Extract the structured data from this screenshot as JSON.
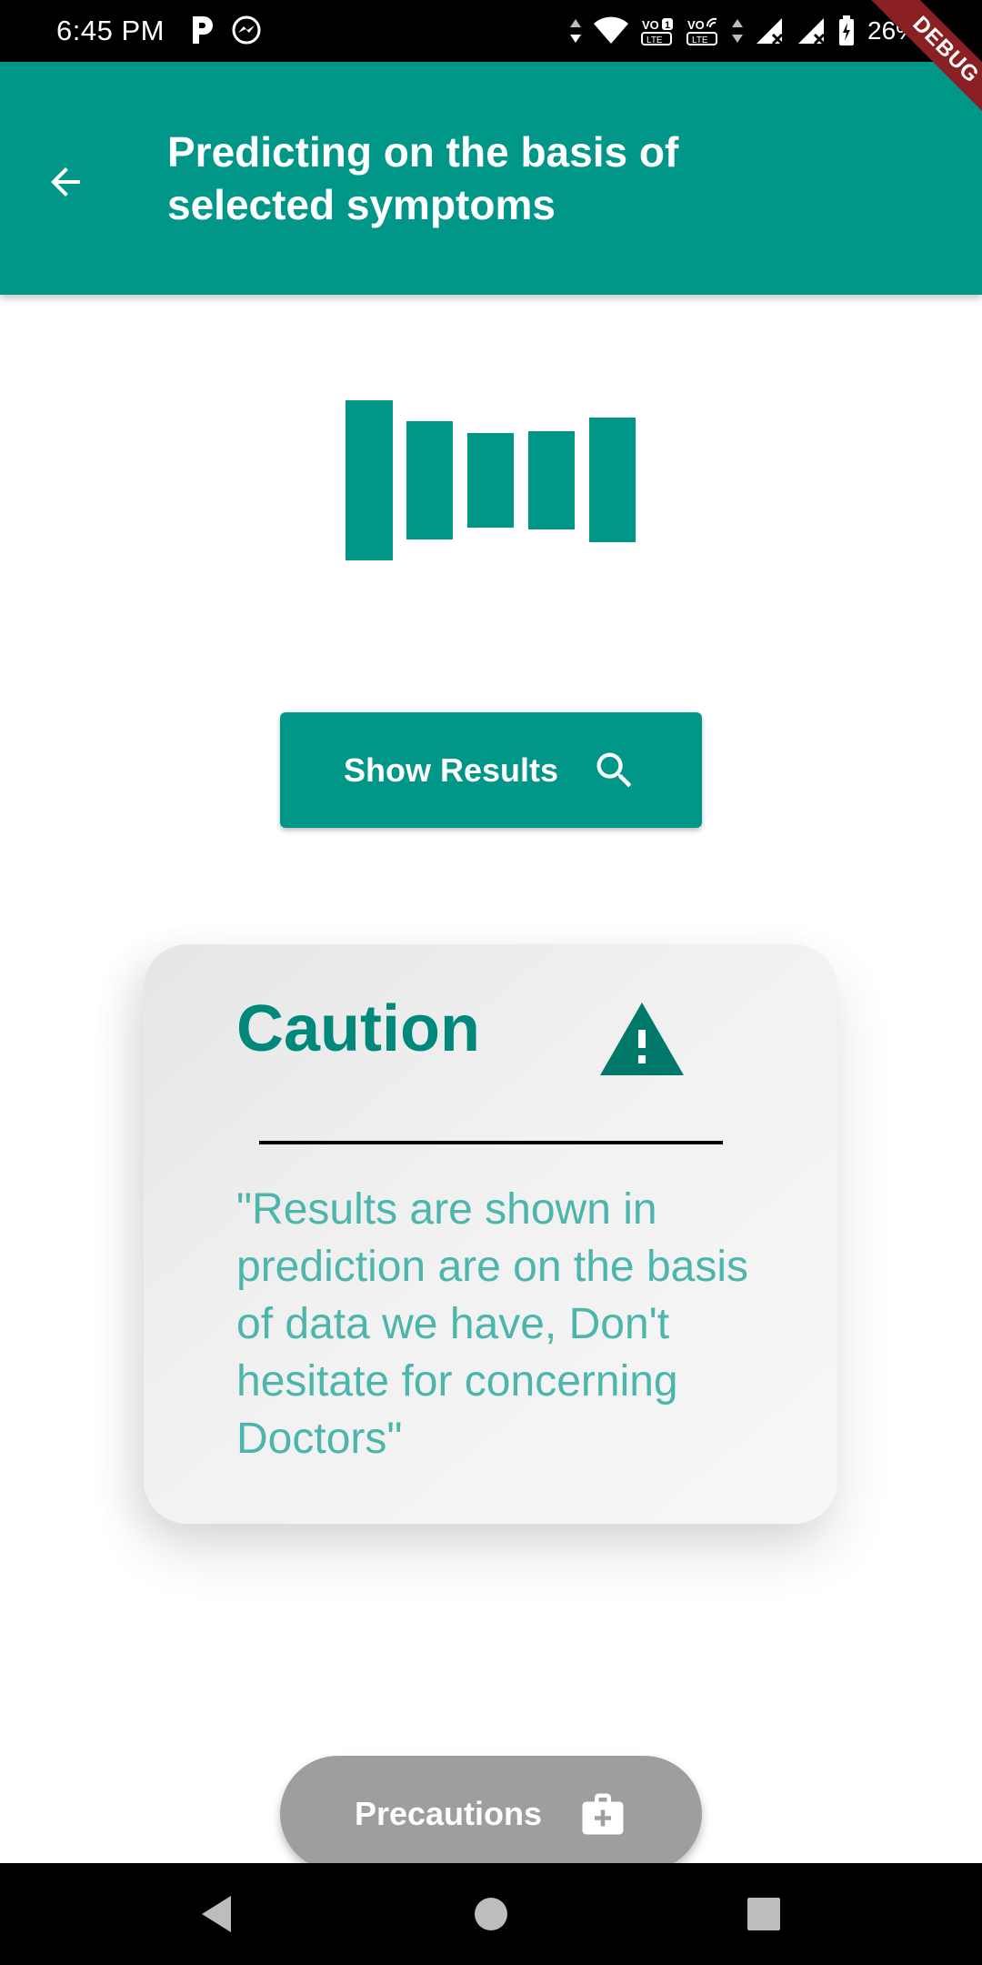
{
  "status_bar": {
    "time": "6:45 PM",
    "battery": "26%",
    "icons": [
      "p-app-icon",
      "messenger-icon",
      "data-arrows-icon",
      "wifi-icon",
      "volte-1-icon",
      "wifi-calling-icon",
      "signal-1-icon",
      "signal-2-icon",
      "battery-charging-icon"
    ]
  },
  "debug_banner": "DEBUG",
  "app_bar": {
    "back_icon": "arrow-back-icon",
    "title": "Predicting on the basis of selected symptoms"
  },
  "loader": {
    "icon": "loading-bars-icon"
  },
  "show_results": {
    "label": "Show Results",
    "icon": "search-icon"
  },
  "caution": {
    "title": "Caution",
    "icon": "warning-icon",
    "message": "\"Results are shown in prediction are on the basis of data we have, Don't hesitate for concerning Doctors\""
  },
  "precautions": {
    "label": "Precautions",
    "icon": "medical-bag-icon"
  },
  "nav_bar": {
    "buttons": [
      "back-triangle-icon",
      "home-circle-icon",
      "recents-square-icon"
    ]
  },
  "colors": {
    "primary": "#009688",
    "caution_title": "#00897b",
    "caution_text": "#4db6ac",
    "warning_icon": "#00796b",
    "precautions_bg": "#9e9e9e",
    "debug_ribbon": "#8a1f24"
  }
}
